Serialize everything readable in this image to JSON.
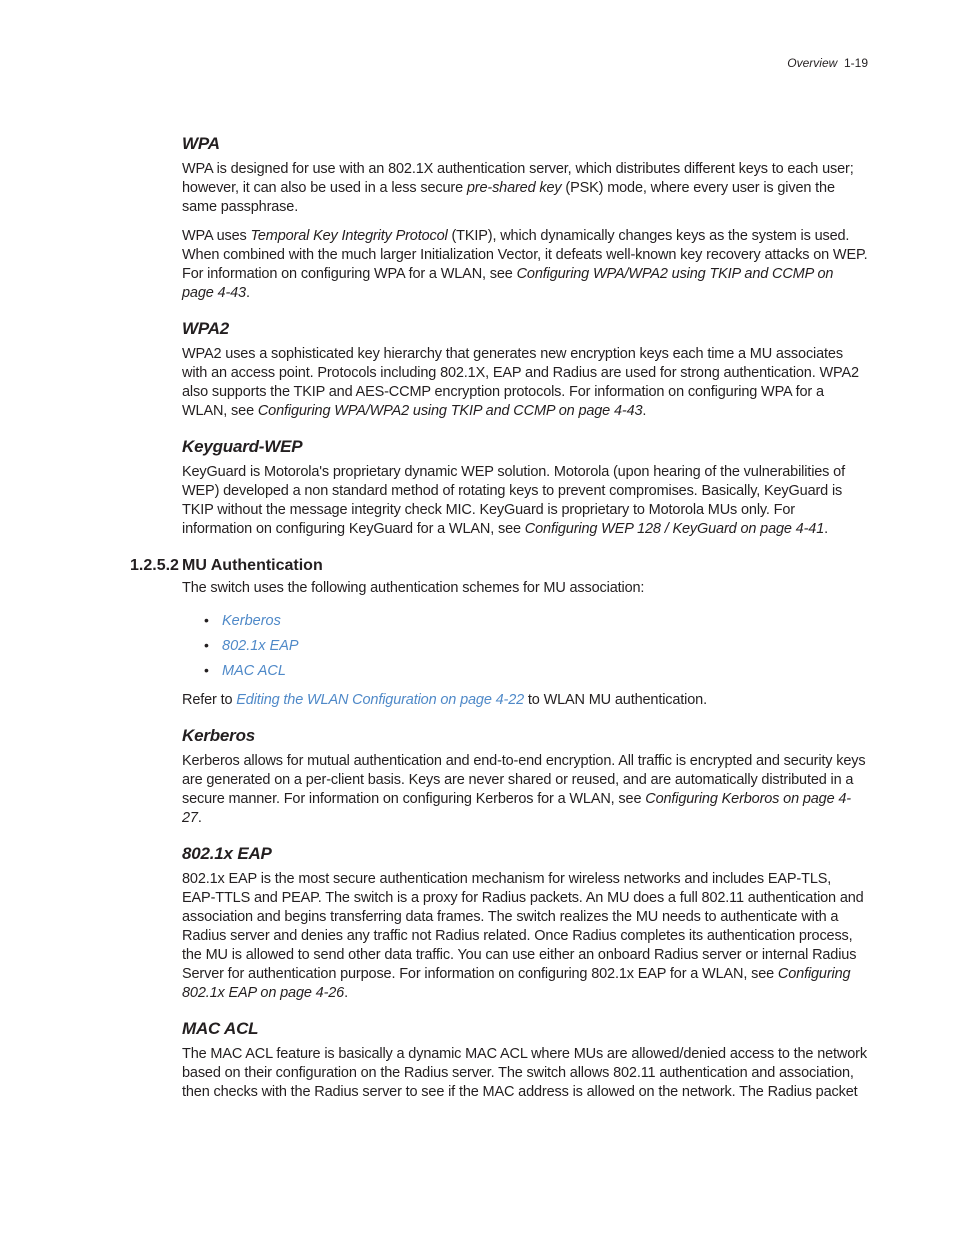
{
  "header": {
    "section": "Overview",
    "page_label": "1-19"
  },
  "wpa": {
    "title": "WPA",
    "p1_a": "WPA is designed for use with an 802.1X authentication server, which distributes different keys to each user; however, it can also be used in a less secure ",
    "p1_i": "pre-shared key",
    "p1_b": " (PSK) mode, where every user is given the same passphrase.",
    "p2_a": "WPA uses ",
    "p2_i": "Temporal Key Integrity Protocol",
    "p2_b": " (TKIP), which dynamically changes keys as the system is used. When combined with the much larger Initialization Vector, it defeats well-known key recovery attacks on WEP. For information on configuring WPA for a WLAN, see ",
    "p2_i2": "Configuring WPA/WPA2 using TKIP and CCMP on page 4-43",
    "p2_c": "."
  },
  "wpa2": {
    "title": "WPA2",
    "p1_a": "WPA2 uses a sophisticated key hierarchy that generates new encryption keys each time a MU associates with an access point. Protocols including 802.1X, EAP and Radius are used for strong authentication. WPA2 also supports the TKIP and AES-CCMP encryption protocols. For information on configuring WPA for a WLAN, see ",
    "p1_i": "Configuring WPA/WPA2 using TKIP and CCMP on page 4-43",
    "p1_b": "."
  },
  "keyguard": {
    "title": "Keyguard-WEP",
    "p1_a": "KeyGuard is Motorola's proprietary dynamic WEP solution. Motorola (upon hearing of the vulnerabilities of WEP) developed a non standard method of rotating keys to prevent compromises. Basically, KeyGuard is TKIP without the message integrity check MIC. KeyGuard is proprietary to Motorola MUs only. For information on configuring KeyGuard for a WLAN, see ",
    "p1_i": "Configuring WEP 128 / KeyGuard on page 4-41",
    "p1_b": "."
  },
  "muauth": {
    "num": "1.2.5.2",
    "title": "MU Authentication",
    "intro": "The switch uses the following authentication schemes for MU association:",
    "links": [
      "Kerberos",
      "802.1x EAP",
      "MAC ACL"
    ],
    "refer_a": "Refer to ",
    "refer_link": "Editing the WLAN Configuration on page 4-22",
    "refer_b": " to WLAN MU authentication."
  },
  "kerberos": {
    "title": "Kerberos",
    "p1_a": "Kerberos allows for mutual authentication and end-to-end encryption. All traffic is encrypted and security keys are generated on a per-client basis. Keys are never shared or reused, and are automatically distributed in a secure manner. For information on configuring Kerberos for a WLAN, see ",
    "p1_i": "Configuring Kerboros on page 4-27",
    "p1_b": "."
  },
  "eap": {
    "title": "802.1x EAP",
    "p1_a": "802.1x EAP is the most secure authentication mechanism for wireless networks and includes EAP-TLS, EAP-TTLS and PEAP. The switch is a proxy for Radius packets. An MU does a full 802.11 authentication and association and begins transferring data frames. The switch realizes the MU needs to authenticate with a Radius server and denies any traffic not Radius related. Once Radius completes its authentication process, the MU is allowed to send other data traffic. You can use either an onboard Radius server or internal Radius Server for authentication purpose. For information on configuring 802.1x EAP for a WLAN, see ",
    "p1_i": "Configuring 802.1x EAP on page 4-26",
    "p1_b": "."
  },
  "macacl": {
    "title": "MAC ACL",
    "p1": "The MAC ACL feature is basically a dynamic MAC ACL where MUs are allowed/denied access to the network based on their configuration on the Radius server. The switch allows 802.11 authentication and association, then checks with the Radius server to see if the MAC address is allowed on the network. The Radius packet"
  }
}
